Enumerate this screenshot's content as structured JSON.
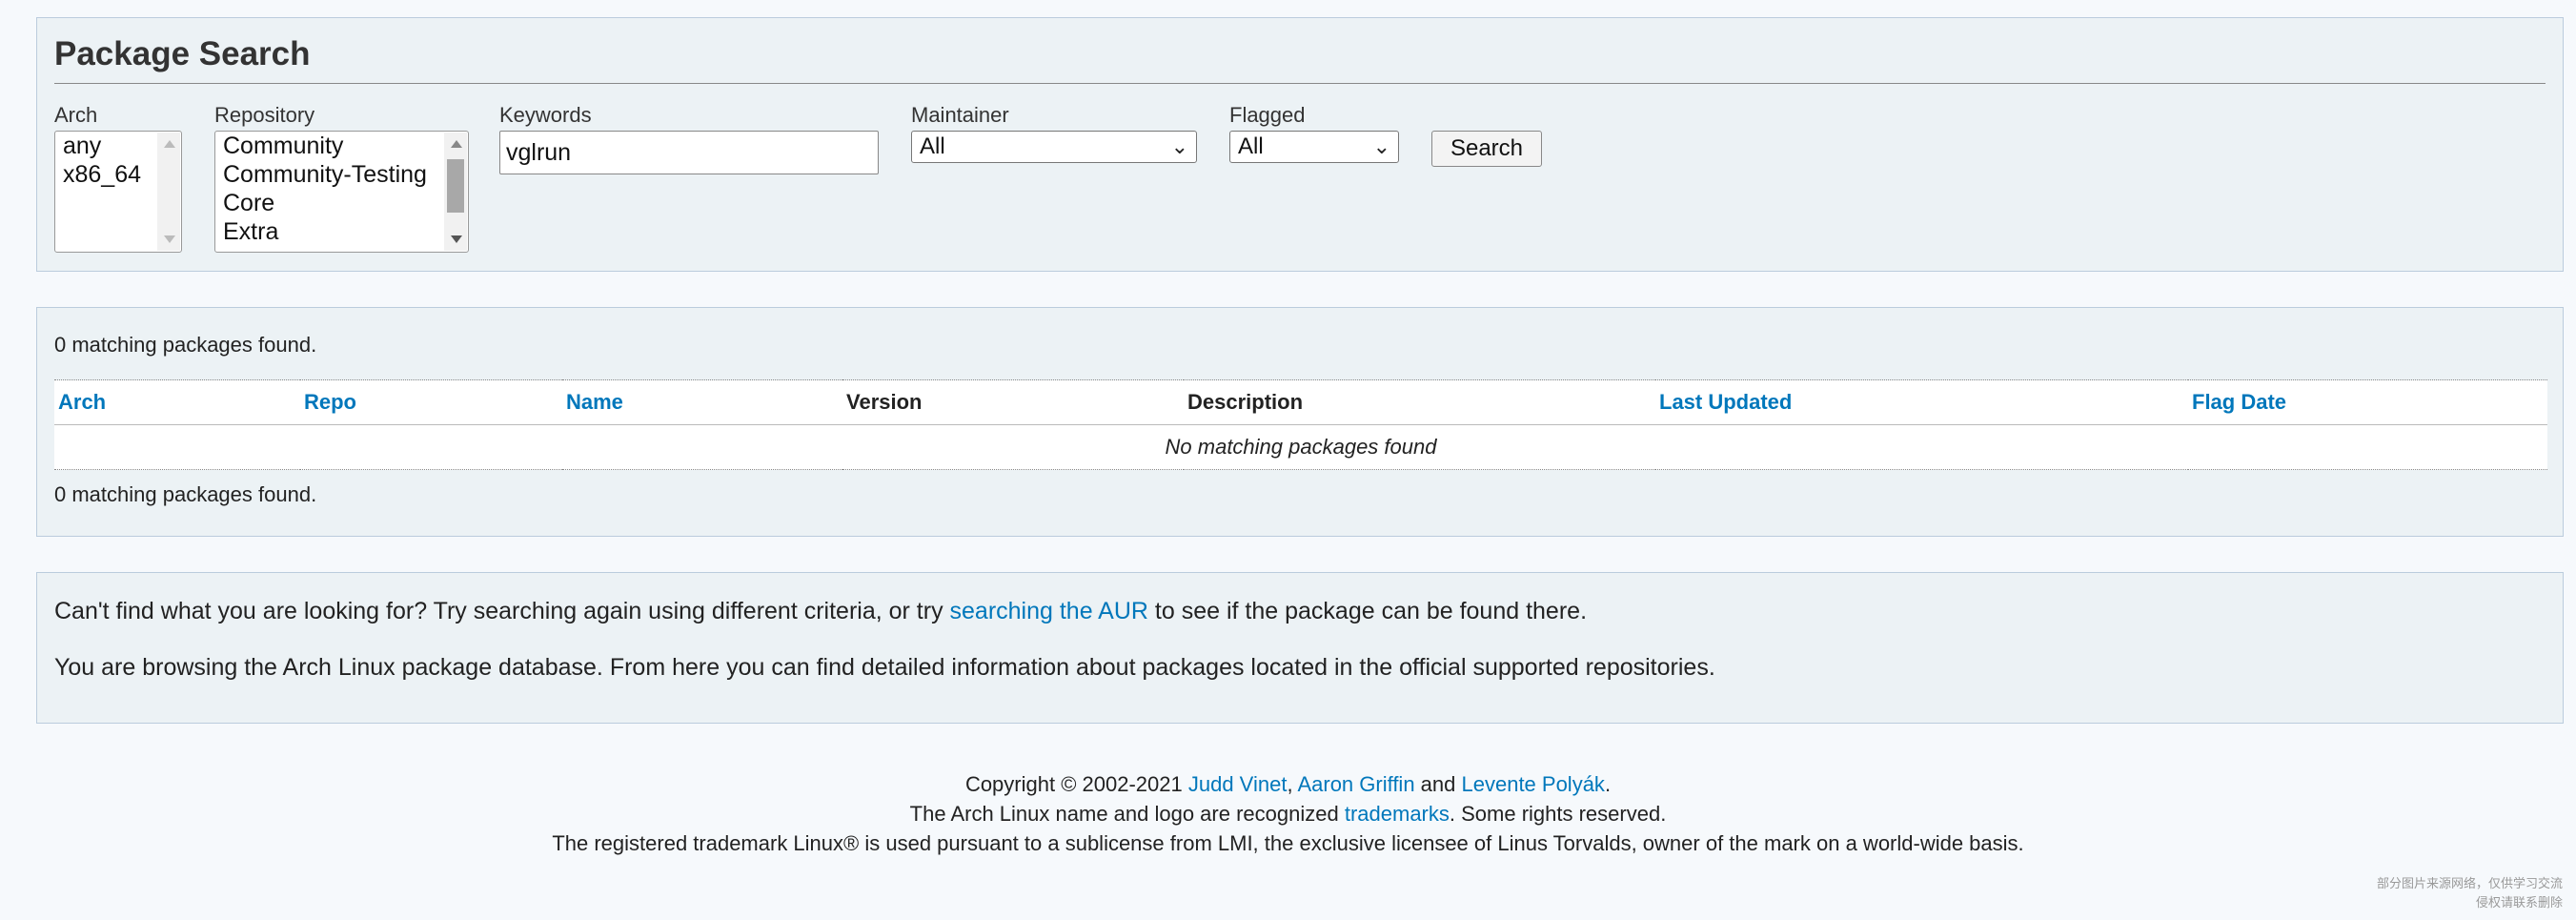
{
  "search": {
    "title": "Package Search",
    "arch_label": "Arch",
    "arch_options": [
      "any",
      "x86_64"
    ],
    "repo_label": "Repository",
    "repo_options": [
      "Community",
      "Community-Testing",
      "Core",
      "Extra"
    ],
    "keywords_label": "Keywords",
    "keywords_value": "vglrun",
    "maintainer_label": "Maintainer",
    "maintainer_value": "All",
    "flagged_label": "Flagged",
    "flagged_value": "All",
    "search_button": "Search"
  },
  "results": {
    "count_top": "0 matching packages found.",
    "count_bottom": "0 matching packages found.",
    "columns": {
      "arch": "Arch",
      "repo": "Repo",
      "name": "Name",
      "version": "Version",
      "description": "Description",
      "last_updated": "Last Updated",
      "flag_date": "Flag Date"
    },
    "empty_message": "No matching packages found"
  },
  "info": {
    "line1_before": "Can't find what you are looking for? Try searching again using different criteria, or try ",
    "line1_link": "searching the AUR",
    "line1_after": " to see if the package can be found there.",
    "line2": "You are browsing the Arch Linux package database. From here you can find detailed information about packages located in the official supported repositories."
  },
  "footer": {
    "copyright_prefix": "Copyright © 2002-2021 ",
    "author1": "Judd Vinet",
    "sep1": ", ",
    "author2": "Aaron Griffin",
    "sep2": " and ",
    "author3": "Levente Polyák",
    "end1": ".",
    "trademark_prefix": "The Arch Linux name and logo are recognized ",
    "trademarks_link": "trademarks",
    "trademark_suffix": ". Some rights reserved.",
    "linux_notice": "The registered trademark Linux® is used pursuant to a sublicense from LMI, the exclusive licensee of Linus Torvalds, owner of the mark on a world-wide basis."
  },
  "corner_note": {
    "line1": "部分图片来源网络，仅供学习交流",
    "line2": "侵权请联系删除"
  },
  "colors": {
    "link": "#0077bb",
    "panel_bg": "#ecf2f5",
    "panel_border": "#bbccdd",
    "page_bg": "#f6f9fc"
  }
}
